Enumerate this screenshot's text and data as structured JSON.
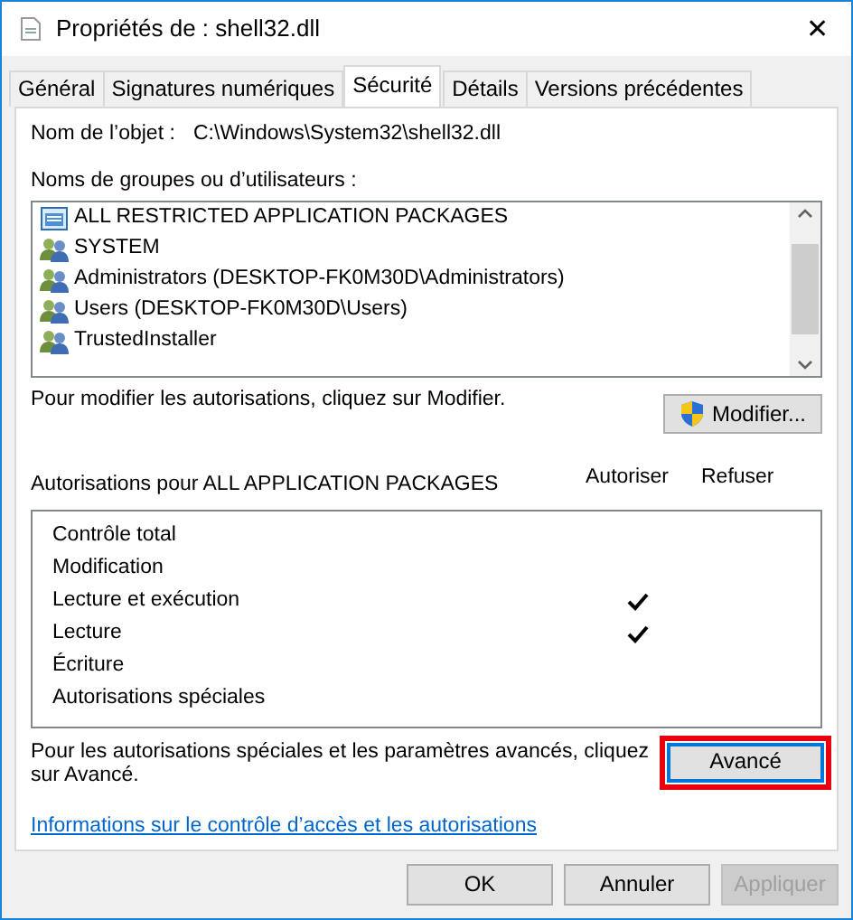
{
  "window": {
    "title": "Propriétés de : shell32.dll",
    "close": "✕"
  },
  "tabs": [
    {
      "label": "Général",
      "selected": false
    },
    {
      "label": "Signatures numériques",
      "selected": false
    },
    {
      "label": "Sécurité",
      "selected": true
    },
    {
      "label": "Détails",
      "selected": false
    },
    {
      "label": "Versions précédentes",
      "selected": false
    }
  ],
  "object_name": {
    "label": "Nom de l’objet :",
    "value": "C:\\Windows\\System32\\shell32.dll"
  },
  "principals": {
    "label": "Noms de groupes ou d’utilisateurs :",
    "items": [
      {
        "kind": "package",
        "name": "ALL RESTRICTED APPLICATION PACKAGES",
        "selected": false
      },
      {
        "kind": "group",
        "name": "SYSTEM",
        "selected": false
      },
      {
        "kind": "group",
        "name": "Administrators (DESKTOP-FK0M30D\\Administrators)",
        "selected": false
      },
      {
        "kind": "group",
        "name": "Users (DESKTOP-FK0M30D\\Users)",
        "selected": false
      },
      {
        "kind": "group",
        "name": "TrustedInstaller",
        "selected": false
      }
    ]
  },
  "modify": {
    "hint": "Pour modifier les autorisations, cliquez sur Modifier.",
    "button": "Modifier..."
  },
  "permissions": {
    "title": "Autorisations pour ALL APPLICATION PACKAGES",
    "allow_header": "Autoriser",
    "deny_header": "Refuser",
    "rows": [
      {
        "name": "Contrôle total",
        "allow": false,
        "deny": false
      },
      {
        "name": "Modification",
        "allow": false,
        "deny": false
      },
      {
        "name": "Lecture et exécution",
        "allow": true,
        "deny": false
      },
      {
        "name": "Lecture",
        "allow": true,
        "deny": false
      },
      {
        "name": "Écriture",
        "allow": false,
        "deny": false
      },
      {
        "name": "Autorisations spéciales",
        "allow": false,
        "deny": false
      }
    ]
  },
  "advanced": {
    "hint": "Pour les autorisations spéciales et les paramètres avancés, cliquez sur Avancé.",
    "button": "Avancé",
    "highlighted": true
  },
  "help_link": "Informations sur le contrôle d’accès et les autorisations",
  "buttons": [
    {
      "label": "OK",
      "disabled": false
    },
    {
      "label": "Annuler",
      "disabled": false
    },
    {
      "label": "Appliquer",
      "disabled": true
    }
  ]
}
